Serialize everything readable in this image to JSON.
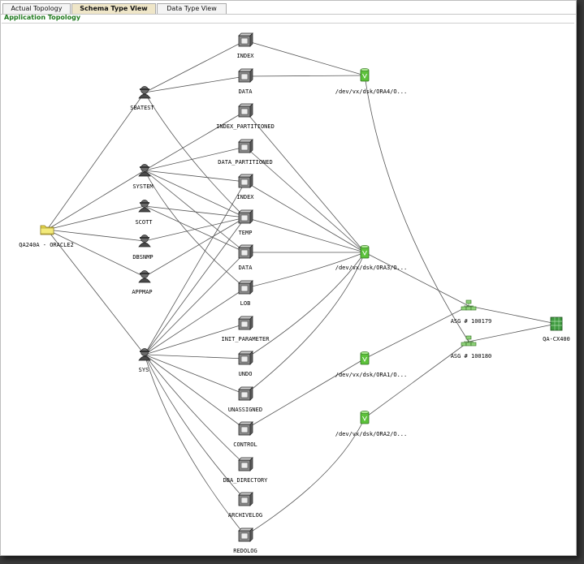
{
  "tabs": [
    {
      "label": "Actual Topology"
    },
    {
      "label": "Schema Type View"
    },
    {
      "label": "Data Type View"
    }
  ],
  "active_tab": 1,
  "app_title": "Application Topology",
  "colors": {
    "title_green": "#1f7a1f",
    "active_tab_bg": "#efe6c8",
    "volume_green": "#5cc23a",
    "folder_yellow": "#e8d84a"
  },
  "nodes": {
    "root": {
      "label": "QA240A - ORACLE2",
      "icon": "folder-icon"
    },
    "sbatest": {
      "label": "SBATEST",
      "icon": "user-icon"
    },
    "system": {
      "label": "SYSTEM",
      "icon": "user-icon"
    },
    "scott": {
      "label": "SCOTT",
      "icon": "user-icon"
    },
    "dbsnmp": {
      "label": "DBSNMP",
      "icon": "user-icon"
    },
    "appmap": {
      "label": "APPMAP",
      "icon": "user-icon"
    },
    "sys": {
      "label": "SYS",
      "icon": "user-icon"
    },
    "t_index1": {
      "label": "INDEX",
      "icon": "tablespace-icon"
    },
    "t_data1": {
      "label": "DATA",
      "icon": "tablespace-icon"
    },
    "t_indexp": {
      "label": "INDEX_PARTITIONED",
      "icon": "tablespace-icon"
    },
    "t_datap": {
      "label": "DATA_PARTITIONED",
      "icon": "tablespace-icon"
    },
    "t_index2": {
      "label": "INDEX",
      "icon": "tablespace-icon"
    },
    "t_temp": {
      "label": "TEMP",
      "icon": "tablespace-icon"
    },
    "t_data2": {
      "label": "DATA",
      "icon": "tablespace-icon"
    },
    "t_lob": {
      "label": "LOB",
      "icon": "tablespace-icon"
    },
    "t_init": {
      "label": "INIT_PARAMETER",
      "icon": "tablespace-icon"
    },
    "t_undo": {
      "label": "UNDO",
      "icon": "tablespace-icon"
    },
    "t_unass": {
      "label": "UNASSIGNED",
      "icon": "tablespace-icon"
    },
    "t_control": {
      "label": "CONTROL",
      "icon": "tablespace-icon"
    },
    "t_dbadir": {
      "label": "DBA_DIRECTORY",
      "icon": "tablespace-icon"
    },
    "t_arch": {
      "label": "ARCHIVELOG",
      "icon": "tablespace-icon"
    },
    "t_redo": {
      "label": "REDOLOG",
      "icon": "tablespace-icon"
    },
    "v_ora4": {
      "label": "/dev/vx/dsk/ORA4/O...",
      "icon": "volume-icon"
    },
    "v_ora3": {
      "label": "/dev/vx/dsk/ORA3/O...",
      "icon": "volume-icon"
    },
    "v_ora1": {
      "label": "/dev/vx/dsk/ORA1/O...",
      "icon": "volume-icon"
    },
    "v_ora2": {
      "label": "/dev/vx/dsk/ORA2/O...",
      "icon": "volume-icon"
    },
    "asg179": {
      "label": "ASG # 100179",
      "icon": "storage-group-icon"
    },
    "asg180": {
      "label": "ASG # 100180",
      "icon": "storage-group-icon"
    },
    "array": {
      "label": "QA-CX400",
      "icon": "storage-array-icon"
    }
  },
  "edges": [
    [
      "root",
      "sbatest"
    ],
    [
      "root",
      "system"
    ],
    [
      "root",
      "scott"
    ],
    [
      "root",
      "dbsnmp"
    ],
    [
      "root",
      "appmap"
    ],
    [
      "root",
      "sys"
    ],
    [
      "sbatest",
      "t_index1"
    ],
    [
      "sbatest",
      "t_data1"
    ],
    [
      "sbatest",
      "t_temp"
    ],
    [
      "system",
      "t_indexp"
    ],
    [
      "system",
      "t_datap"
    ],
    [
      "system",
      "t_index2"
    ],
    [
      "system",
      "t_temp"
    ],
    [
      "system",
      "t_data2"
    ],
    [
      "system",
      "t_lob"
    ],
    [
      "scott",
      "t_temp"
    ],
    [
      "scott",
      "t_data2"
    ],
    [
      "dbsnmp",
      "t_temp"
    ],
    [
      "appmap",
      "t_temp"
    ],
    [
      "sys",
      "t_index2"
    ],
    [
      "sys",
      "t_temp"
    ],
    [
      "sys",
      "t_data2"
    ],
    [
      "sys",
      "t_lob"
    ],
    [
      "sys",
      "t_init"
    ],
    [
      "sys",
      "t_undo"
    ],
    [
      "sys",
      "t_unass"
    ],
    [
      "sys",
      "t_control"
    ],
    [
      "sys",
      "t_dbadir"
    ],
    [
      "sys",
      "t_arch"
    ],
    [
      "sys",
      "t_redo"
    ],
    [
      "t_index1",
      "v_ora4"
    ],
    [
      "t_data1",
      "v_ora4"
    ],
    [
      "t_indexp",
      "v_ora3"
    ],
    [
      "t_datap",
      "v_ora3"
    ],
    [
      "t_index2",
      "v_ora3"
    ],
    [
      "t_temp",
      "v_ora3"
    ],
    [
      "t_data2",
      "v_ora3"
    ],
    [
      "t_lob",
      "v_ora3"
    ],
    [
      "t_undo",
      "v_ora3"
    ],
    [
      "t_unass",
      "v_ora3"
    ],
    [
      "t_control",
      "v_ora1"
    ],
    [
      "t_redo",
      "v_ora2"
    ],
    [
      "v_ora4",
      "asg180"
    ],
    [
      "v_ora3",
      "asg179"
    ],
    [
      "v_ora1",
      "asg179"
    ],
    [
      "v_ora2",
      "asg180"
    ],
    [
      "asg179",
      "array"
    ],
    [
      "asg180",
      "array"
    ]
  ]
}
